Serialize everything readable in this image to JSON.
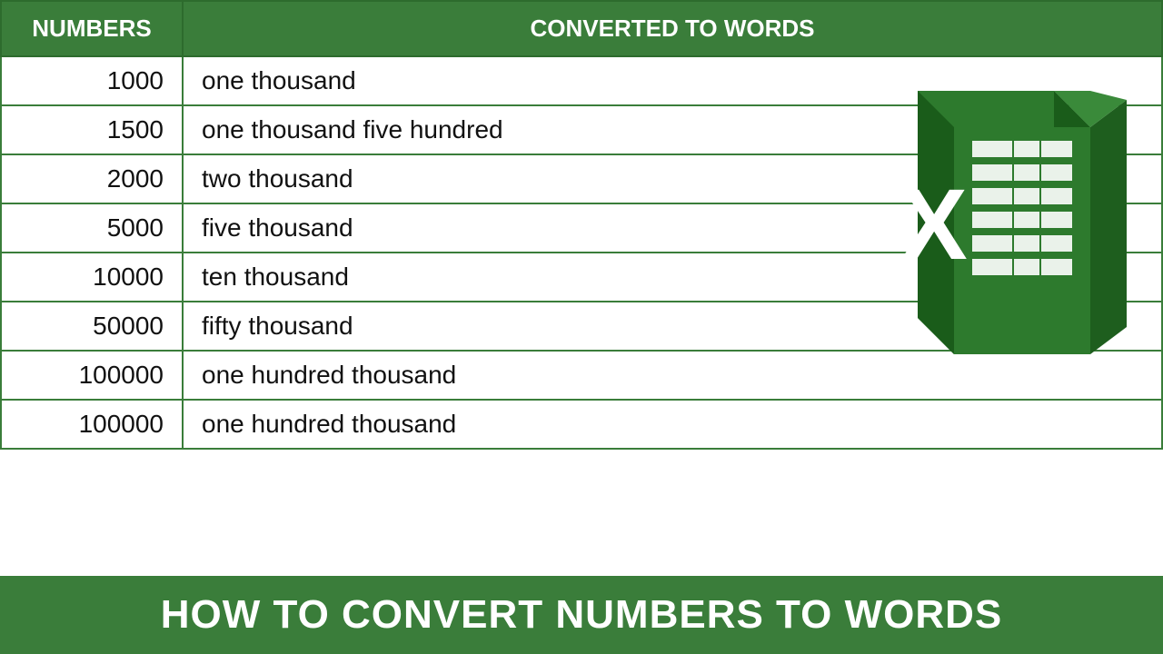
{
  "header": {
    "col1": "NUMBERS",
    "col2": "CONVERTED TO WORDS"
  },
  "rows": [
    {
      "number": "1000",
      "words": "one thousand"
    },
    {
      "number": "1500",
      "words": "one thousand five hundred"
    },
    {
      "number": "2000",
      "words": "two thousand"
    },
    {
      "number": "5000",
      "words": "five thousand"
    },
    {
      "number": "10000",
      "words": "ten thousand"
    },
    {
      "number": "50000",
      "words": "fifty thousand"
    },
    {
      "number": "100000",
      "words": "one hundred thousand"
    },
    {
      "number": "100000",
      "words": "one hundred thousand"
    }
  ],
  "footer": {
    "text": "HOW TO CONVERT NUMBERS TO WORDS"
  },
  "colors": {
    "green": "#3a7d3a",
    "dark_green": "#2a5e2a",
    "white": "#ffffff"
  }
}
